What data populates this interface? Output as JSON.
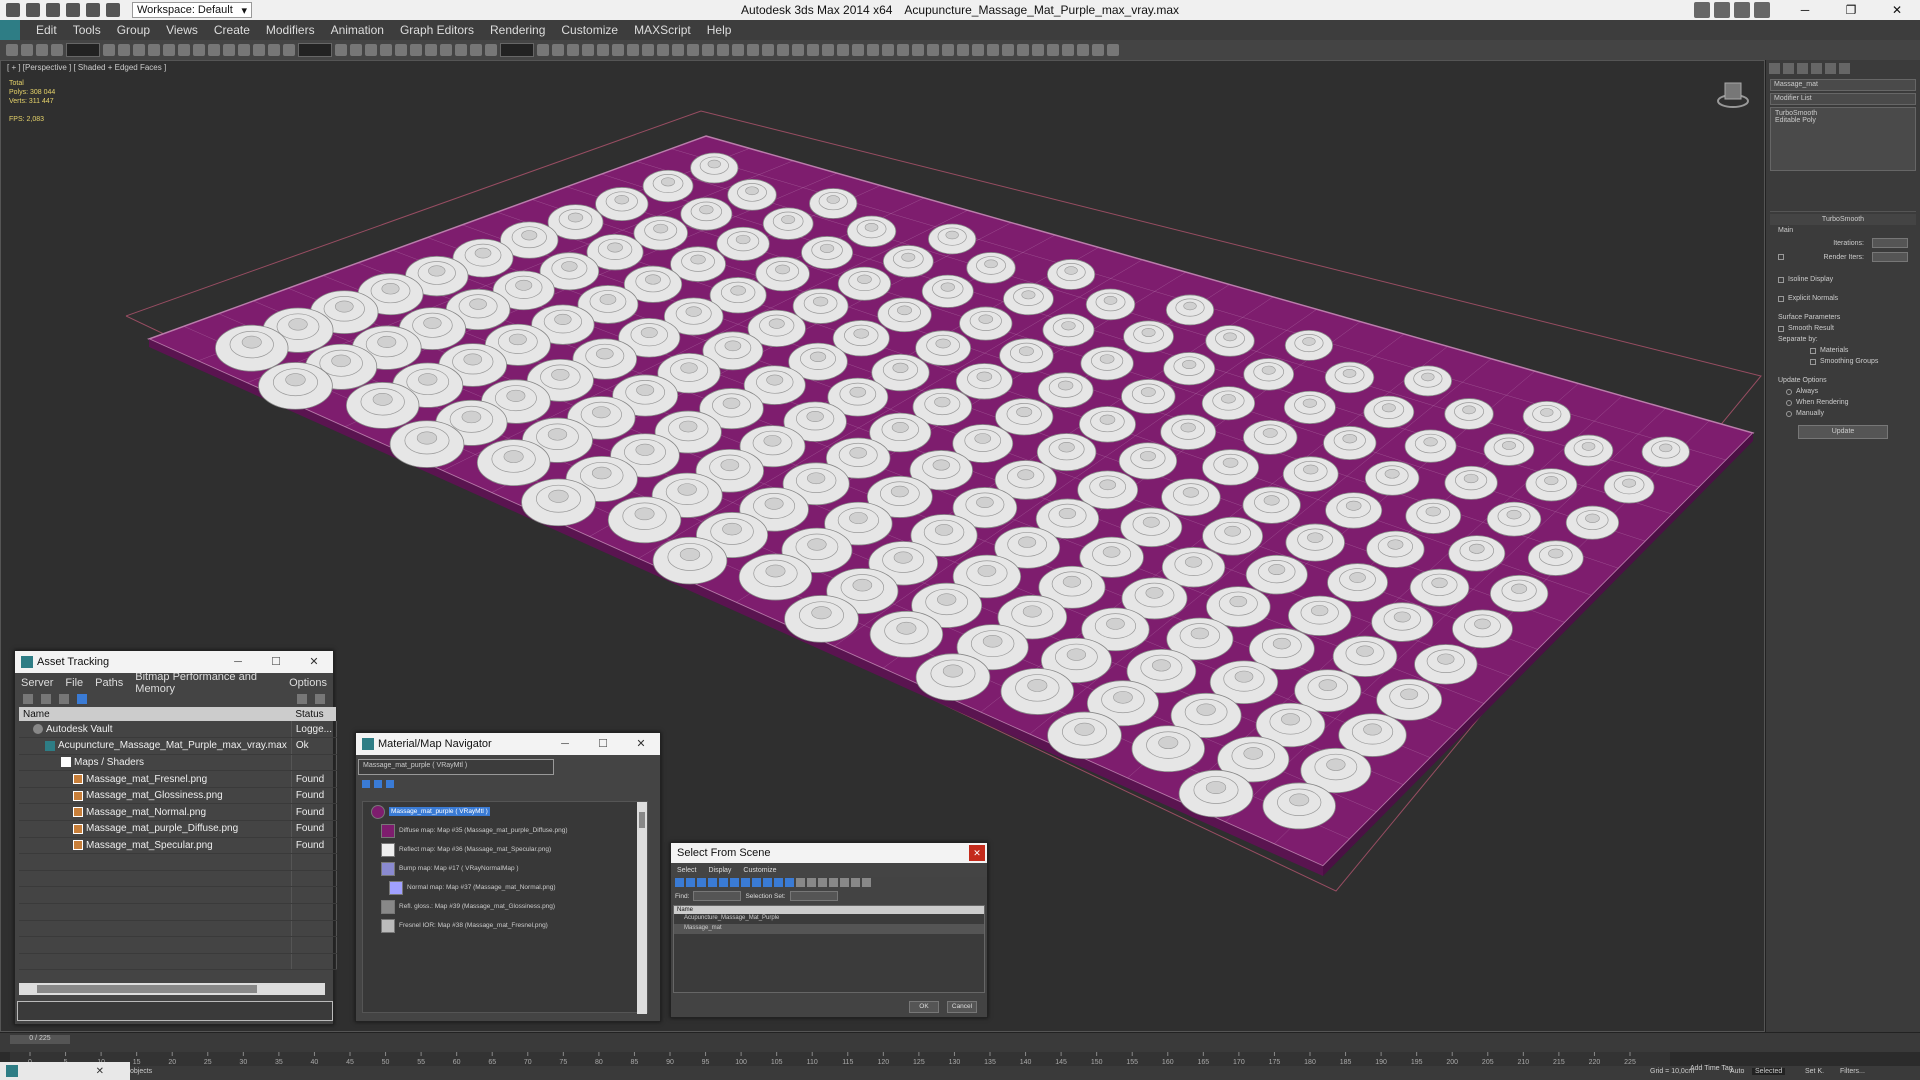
{
  "titlebar": {
    "workspace": "Workspace: Default",
    "app_name": "Autodesk 3ds Max  2014 x64",
    "file_name": "Acupuncture_Massage_Mat_Purple_max_vray.max"
  },
  "menu": [
    "Edit",
    "Tools",
    "Group",
    "Views",
    "Create",
    "Modifiers",
    "Animation",
    "Graph Editors",
    "Rendering",
    "Customize",
    "MAXScript",
    "Help"
  ],
  "viewport": {
    "label": "[ + ] [Perspective ] [ Shaded + Edged Faces ]",
    "stats": {
      "total": "Total",
      "polys_label": "Polys:",
      "polys": "308 044",
      "verts_label": "Verts:",
      "verts": "311 447",
      "fps_label": "FPS:",
      "fps": "2,083"
    },
    "mat_color": "#7e1d6e",
    "stud_color": "#e6e6e6"
  },
  "command_panel": {
    "object_name": "Massage_mat",
    "modifier_list": "Modifier List",
    "stack": [
      "TurboSmooth",
      "Editable Poly"
    ],
    "rollout_title": "TurboSmooth",
    "main_label": "Main",
    "iterations": "Iterations:",
    "render_iters": "Render Iters:",
    "isoline": "Isoline Display",
    "explicit": "Explicit Normals",
    "surface_params": "Surface Parameters",
    "smooth_result": "Smooth Result",
    "separate_by": "Separate by:",
    "materials": "Materials",
    "smoothing_groups": "Smoothing Groups",
    "update_options": "Update Options",
    "always": "Always",
    "when_rendering": "When Rendering",
    "manually": "Manually",
    "update_button": "Update"
  },
  "asset_tracking": {
    "title": "Asset Tracking",
    "menu": [
      "Server",
      "File",
      "Paths",
      "Bitmap Performance and Memory",
      "Options"
    ],
    "col_name": "Name",
    "col_status": "Status",
    "rows": [
      {
        "name": "Autodesk Vault",
        "status": "Logge..."
      },
      {
        "name": "Acupuncture_Massage_Mat_Purple_max_vray.max",
        "status": "Ok"
      },
      {
        "name": "Maps / Shaders",
        "status": ""
      },
      {
        "name": "Massage_mat_Fresnel.png",
        "status": "Found"
      },
      {
        "name": "Massage_mat_Glossiness.png",
        "status": "Found"
      },
      {
        "name": "Massage_mat_Normal.png",
        "status": "Found"
      },
      {
        "name": "Massage_mat_purple_Diffuse.png",
        "status": "Found"
      },
      {
        "name": "Massage_mat_Specular.png",
        "status": "Found"
      }
    ]
  },
  "material_nav": {
    "title": "Material/Map Navigator",
    "current": "Massage_mat_purple  ( VRayMtl )",
    "nodes": [
      "Massage_mat_purple  ( VRayMtl )",
      "Diffuse map: Map #35 (Massage_mat_purple_Diffuse.png)",
      "Reflect map: Map #36 (Massage_mat_Specular.png)",
      "Bump map: Map #17  ( VRayNormalMap )",
      "Normal map: Map #37 (Massage_mat_Normal.png)",
      "Refl. gloss.: Map #39 (Massage_mat_Glossiness.png)",
      "Fresnel IOR: Map #38 (Massage_mat_Fresnel.png)"
    ]
  },
  "select_scene": {
    "title": "Select From Scene",
    "menu": [
      "Select",
      "Display",
      "Customize"
    ],
    "find": "Find:",
    "selection_set": "Selection Set:",
    "col_name": "Name",
    "items": [
      "Acupuncture_Massage_Mat_Purple",
      "Massage_mat"
    ],
    "ok": "OK",
    "cancel": "Cancel"
  },
  "timeline": {
    "frame": "0 / 225",
    "ticks": [
      "0",
      "5",
      "10",
      "15",
      "20",
      "25",
      "30",
      "35",
      "40",
      "45",
      "50",
      "55",
      "60",
      "65",
      "70",
      "75",
      "80",
      "85",
      "90",
      "95",
      "100",
      "105",
      "110",
      "115",
      "120",
      "125",
      "130",
      "135",
      "140",
      "145",
      "150",
      "155",
      "160",
      "165",
      "170",
      "175",
      "180",
      "185",
      "190",
      "195",
      "200",
      "205",
      "210",
      "215",
      "220",
      "225"
    ]
  },
  "statusbar": {
    "left": "objects",
    "grid": "Grid = 10,0cm",
    "auto": "Auto",
    "selected": "Selected",
    "setk": "Set K.",
    "filters": "Filters...",
    "addtime": "Add Time Tag"
  }
}
